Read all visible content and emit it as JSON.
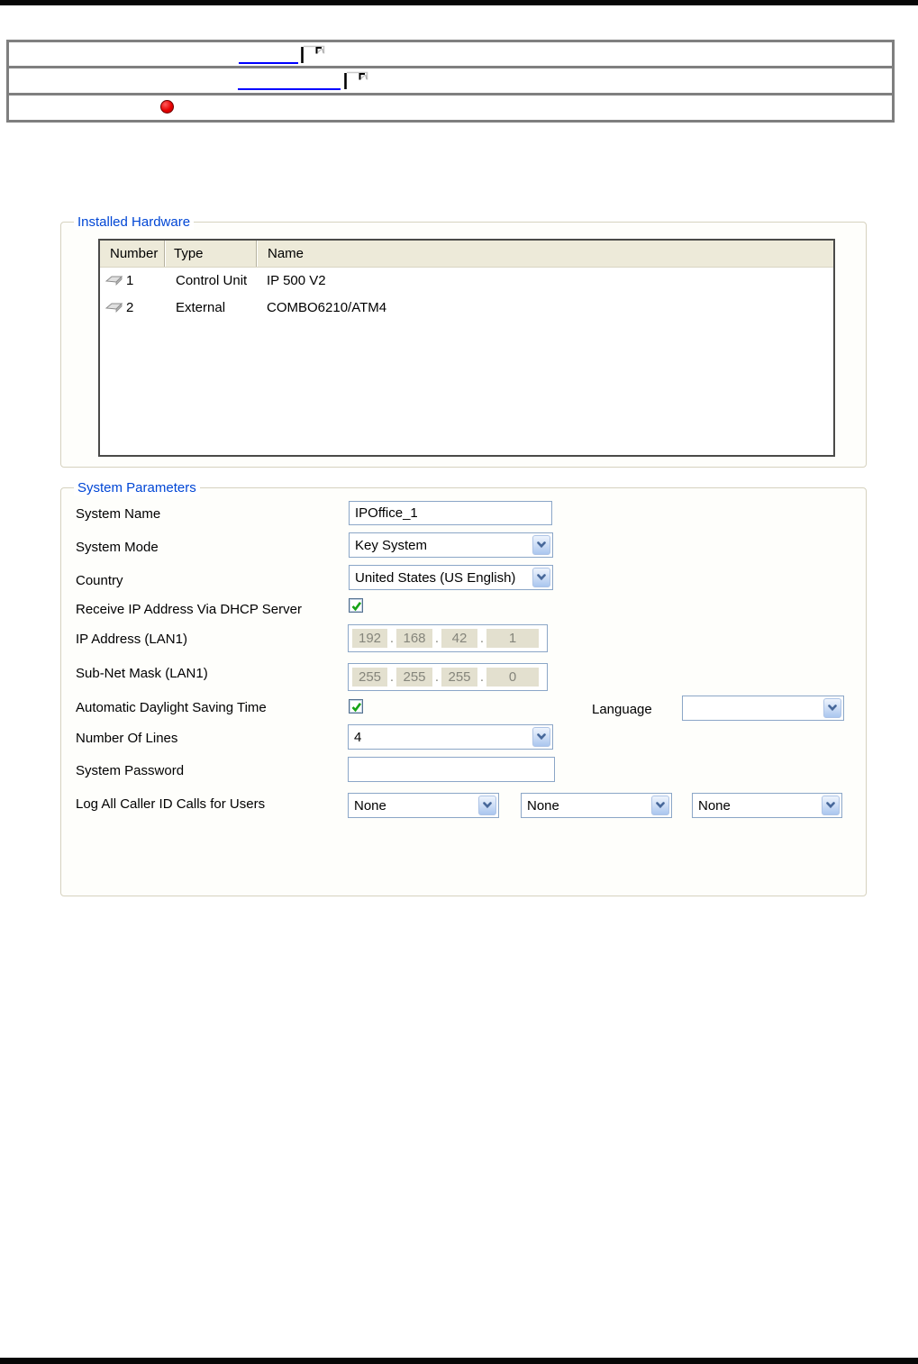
{
  "nav": {
    "rows": [
      {
        "link_text": "",
        "icon": "broken-image-icon"
      },
      {
        "link_text": "",
        "icon": "broken-image-icon"
      },
      {
        "bullet": "red-dot"
      }
    ]
  },
  "installed_hardware": {
    "title": "Installed Hardware",
    "columns": [
      "Number",
      "Type",
      "Name"
    ],
    "rows": [
      {
        "number": "1",
        "type": "Control Unit",
        "name": "IP 500 V2",
        "icon": "device-unit-icon"
      },
      {
        "number": "2",
        "type": "External",
        "name": "COMBO6210/ATM4",
        "icon": "device-unit-icon"
      }
    ]
  },
  "system_parameters": {
    "title": "System Parameters",
    "system_name_label": "System Name",
    "system_name_value": "IPOffice_1",
    "system_mode_label": "System Mode",
    "system_mode_value": "Key System",
    "country_label": "Country",
    "country_value": "United States (US English)",
    "dhcp_label": "Receive IP Address Via DHCP Server",
    "dhcp_checked": true,
    "ip_label": "IP Address (LAN1)",
    "ip_octets": [
      "192",
      "168",
      "42",
      "1"
    ],
    "subnet_label": "Sub-Net Mask (LAN1)",
    "subnet_octets": [
      "255",
      "255",
      "255",
      "0"
    ],
    "octet_separator": ".",
    "adst_label": "Automatic Daylight Saving Time",
    "adst_checked": true,
    "language_label": "Language",
    "language_value": "",
    "lines_label": "Number Of Lines",
    "lines_value": "4",
    "password_label": "System Password",
    "password_value": "",
    "log_label": "Log All Caller ID Calls for Users",
    "log_values": [
      "None",
      "None",
      "None"
    ]
  },
  "colors": {
    "rule_bar": "#070707",
    "nav_border": "#7f7f7f",
    "link": "#0000ff",
    "red_bullet": "#e60000",
    "group_title": "#0046d5",
    "group_border": "#d6d2bf",
    "table_header_bg": "#edead9",
    "control_border": "#8ba6c7",
    "disabled_field_bg": "#e3e0cf",
    "disabled_field_text": "#85857b",
    "check_green": "#17a317"
  }
}
